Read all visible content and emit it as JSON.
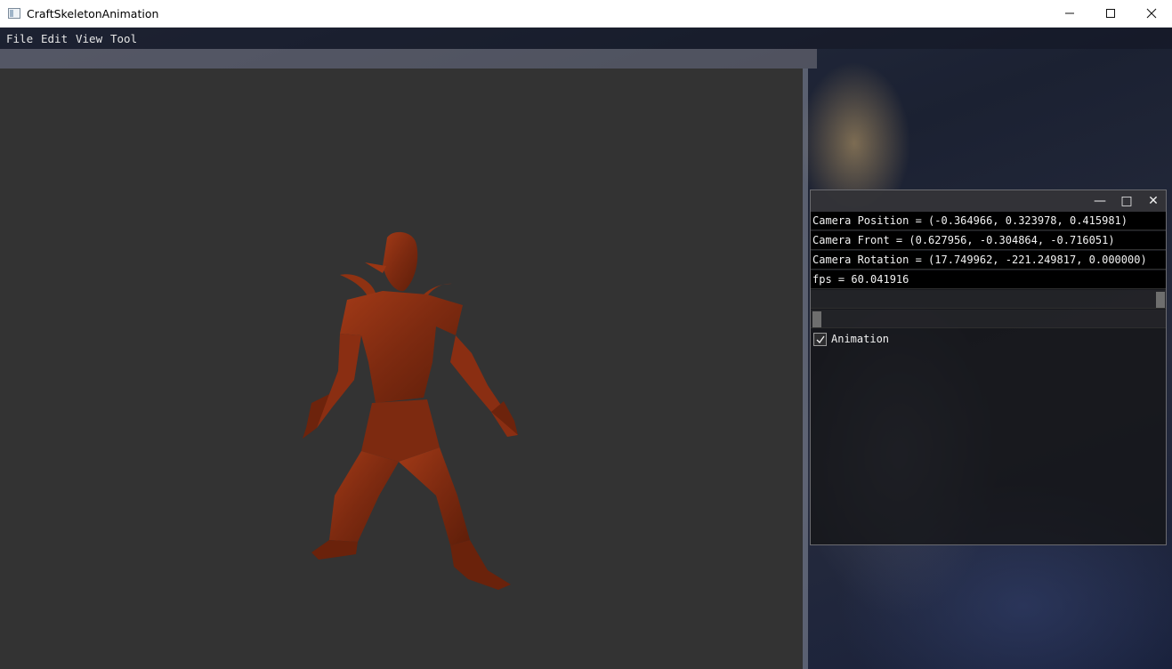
{
  "window": {
    "title": "CraftSkeletonAnimation",
    "minimize_glyph": "—",
    "maximize_glyph": "☐",
    "close_glyph": "✕"
  },
  "menu": {
    "items": [
      "File",
      "Edit",
      "View",
      "Tool"
    ]
  },
  "imgui_panel": {
    "lines": [
      "Camera Position = (-0.364966, 0.323978, 0.415981)",
      "Camera Front = (0.627956, -0.304864, -0.716051)",
      "Camera Rotation = (17.749962, -221.249817, 0.000000)",
      "fps = 60.041916"
    ],
    "checkbox": {
      "label": "Animation",
      "checked": true
    },
    "buttons": {
      "minimize": "—",
      "maximize": "□",
      "close": "✕"
    }
  },
  "colors": {
    "viewport_bg": "#333333",
    "model_color": "#8a2e12",
    "panel_text": "#f2f2f2"
  },
  "icons": [
    "app-icon",
    "minimize-icon",
    "maximize-icon",
    "close-icon",
    "checkmark-icon"
  ]
}
